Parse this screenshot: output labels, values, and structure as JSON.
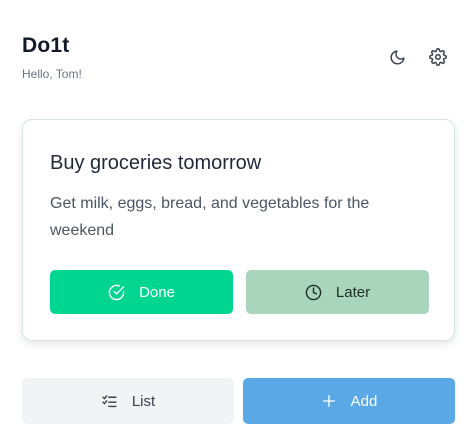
{
  "header": {
    "app_title": "Do1t",
    "greeting": "Hello, Tom!",
    "icons": [
      "moon-icon",
      "gear-icon"
    ]
  },
  "task_card": {
    "title": "Buy groceries tomorrow",
    "description": "Get milk, eggs, bread, and vegetables for the weekend",
    "done_label": "Done",
    "later_label": "Later",
    "done_icon": "check-circle-icon",
    "later_icon": "clock-icon"
  },
  "footer": {
    "list_label": "List",
    "add_label": "Add",
    "list_icon": "checklist-icon",
    "add_icon": "plus-icon"
  },
  "colors": {
    "done_button": "#00d68f",
    "later_button": "#a8d5bc",
    "add_button": "#5aa9e6",
    "list_button": "#f2f3f5"
  }
}
